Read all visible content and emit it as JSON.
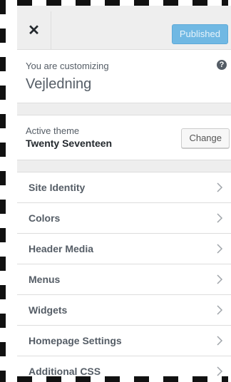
{
  "header": {
    "close_icon": "close-icon",
    "publish_button": "Published",
    "publish_color": "#70b8e3"
  },
  "customizing": {
    "label": "You are customizing",
    "site_title": "Vejledning",
    "help_icon": "?"
  },
  "theme": {
    "label": "Active theme",
    "name": "Twenty Seventeen",
    "change_button": "Change"
  },
  "sections": [
    {
      "label": "Site Identity",
      "icon": "chevron-right-icon"
    },
    {
      "label": "Colors",
      "icon": "chevron-right-icon"
    },
    {
      "label": "Header Media",
      "icon": "chevron-right-icon"
    },
    {
      "label": "Menus",
      "icon": "chevron-right-icon"
    },
    {
      "label": "Widgets",
      "icon": "chevron-right-icon"
    },
    {
      "label": "Homepage Settings",
      "icon": "chevron-right-icon"
    },
    {
      "label": "Additional CSS",
      "icon": "chevron-right-icon"
    }
  ]
}
